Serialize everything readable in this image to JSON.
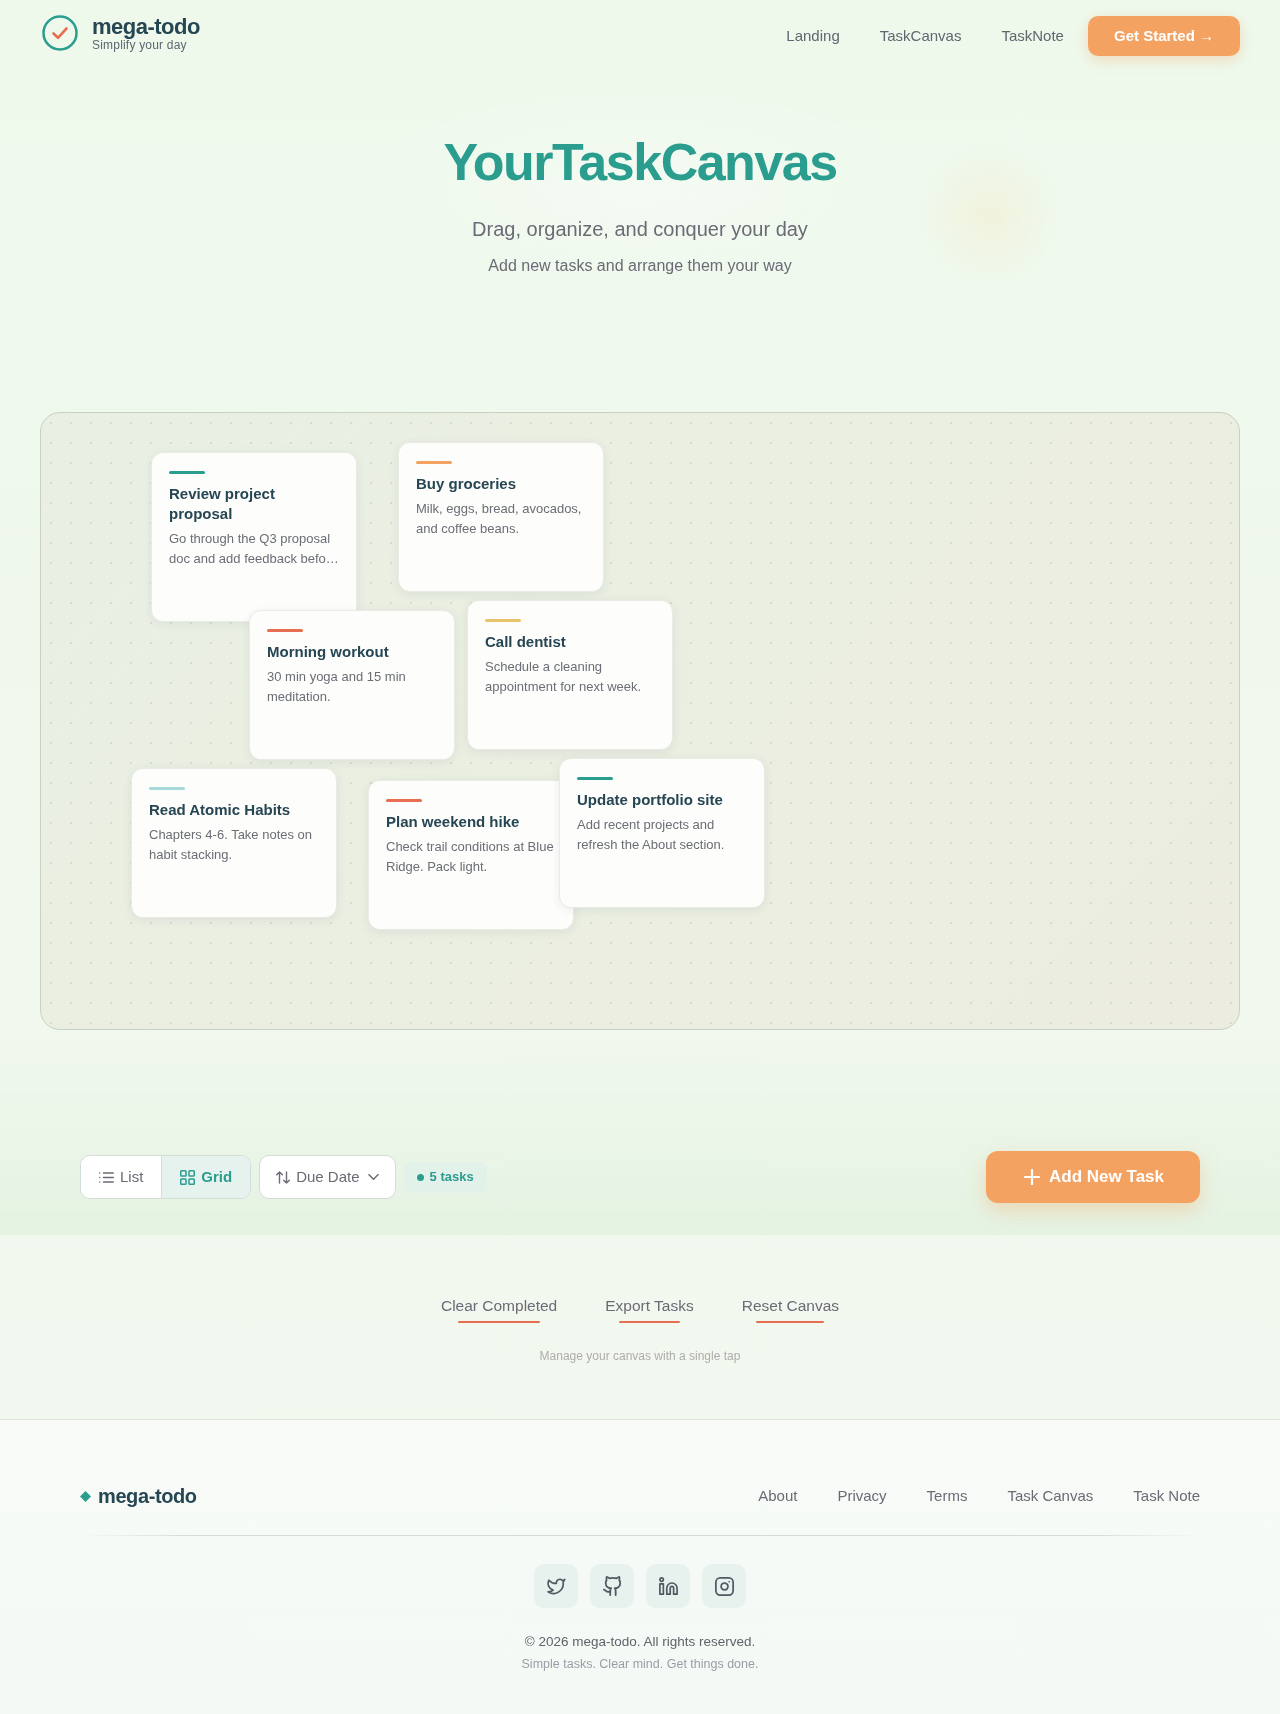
{
  "header": {
    "brand": "mega-todo",
    "tagline": "Simplify your day",
    "nav": [
      "Landing",
      "TaskCanvas",
      "TaskNote"
    ],
    "cta": "Get Started →"
  },
  "hero": {
    "title": "YourTaskCanvas",
    "subtitle": "Drag, organize, and conquer your day",
    "hint": "Add new tasks and arrange them your way"
  },
  "canvas": {
    "cards": [
      {
        "title": "Review project proposal",
        "description": "Go through the Q3 proposal doc and add feedback befo…",
        "color": "#2a9d8f"
      },
      {
        "title": "Buy groceries",
        "description": "Milk, eggs, bread, avocados, and coffee beans.",
        "color": "#f4a261"
      },
      {
        "title": "Morning workout",
        "description": "30 min yoga and 15 min meditation.",
        "color": "#e76f51"
      },
      {
        "title": "Call dentist",
        "description": "Schedule a cleaning appointment for next week.",
        "color": "#e9c46a"
      },
      {
        "title": "Read Atomic Habits",
        "description": "Chapters 4-6. Take notes on habit stacking.",
        "color": "#a8dadc"
      },
      {
        "title": "Plan weekend hike",
        "description": "Check trail conditions at Blue Ridge. Pack light.",
        "color": "#e76f51"
      },
      {
        "title": "Update portfolio site",
        "description": "Add recent projects and refresh the About section.",
        "color": "#2a9d8f"
      }
    ]
  },
  "toolbar": {
    "views": [
      {
        "kind": "list",
        "label": "List",
        "selected": false
      },
      {
        "kind": "grid",
        "label": "Grid",
        "selected": true
      }
    ],
    "sort": "Due Date",
    "task_count": "5 tasks",
    "add_button": "Add New Task"
  },
  "actions": {
    "links": [
      "Clear Completed",
      "Export Tasks",
      "Reset Canvas"
    ],
    "caption": "Manage your canvas with a single tap"
  },
  "footer": {
    "brand": "mega-todo",
    "links": [
      "About",
      "Privacy",
      "Terms",
      "Task Canvas",
      "Task Note"
    ],
    "social": [
      {
        "kind": "twitter"
      },
      {
        "kind": "github"
      },
      {
        "kind": "linkedin"
      },
      {
        "kind": "instagram"
      }
    ],
    "copyright": "© 2026 mega-todo. All rights reserved.",
    "tagline": "Simple tasks. Clear mind. Get things done."
  }
}
